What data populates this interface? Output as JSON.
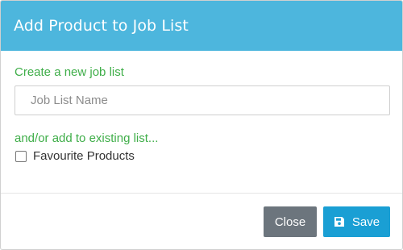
{
  "modal": {
    "title": "Add Product to Job List"
  },
  "new_list": {
    "label": "Create a new job list",
    "input_placeholder": "Job List Name",
    "input_value": ""
  },
  "existing_list": {
    "label": "and/or add to existing list...",
    "options": [
      {
        "label": "Favourite Products",
        "checked": false
      }
    ]
  },
  "footer": {
    "close_label": "Close",
    "save_label": "Save",
    "save_icon": "floppy-disk-icon"
  },
  "colors": {
    "header_bg": "#4db6dd",
    "label_green": "#3fae49",
    "close_bg": "#6c757d",
    "save_bg": "#1a9fd4"
  }
}
